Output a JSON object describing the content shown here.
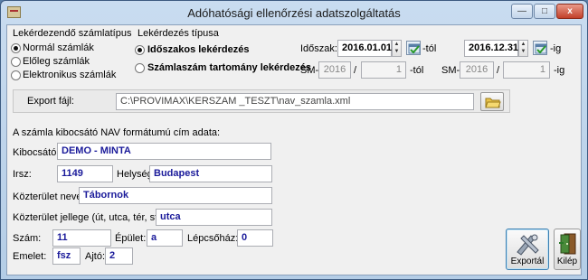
{
  "window": {
    "title": "Adóhatósági ellenőrzési adatszolgáltatás",
    "min_label": "—",
    "max_label": "□",
    "close_label": "x"
  },
  "query_type": {
    "heading": "Lekérdezendő számlatípus",
    "options": [
      "Normál számlák",
      "Előleg számlák",
      "Elektronikus számlák"
    ],
    "selected": 0
  },
  "query_mode": {
    "heading": "Lekérdezés típusa",
    "options": [
      "Időszakos lekérdezés",
      "Számlaszám tartomány lekérdezés"
    ],
    "selected": 0
  },
  "period": {
    "label": "Időszak:",
    "from": "2016.01.01.",
    "from_suffix": "-tól",
    "to": "2016.12.31.",
    "to_suffix": "-ig"
  },
  "invoice_range": {
    "prefix": "SM-",
    "from_year": "2016",
    "from_num": "1",
    "from_suffix": "-tól",
    "to_year": "2016",
    "to_num": "1",
    "to_suffix": "-ig",
    "sep": "/"
  },
  "export": {
    "label": "Export fájl:",
    "path": "C:\\PROVIMAX\\KERSZAM _TESZT\\nav_szamla.xml"
  },
  "address": {
    "heading": "A számla kibocsátó NAV formátumú cím adata:",
    "issuer_label": "Kibocsátó:",
    "issuer": "DEMO - MINTA",
    "zip_label": "Irsz:",
    "zip": "1149",
    "city_label": "Helység:",
    "city": "Budapest",
    "street_label": "Közterület neve:",
    "street": "Tábornok",
    "street_type_label": "Közterület jellege (út, utca, tér, stb.) :",
    "street_type": "utca",
    "number_label": "Szám:",
    "number": "11",
    "building_label": "Épület:",
    "building": "a",
    "stair_label": "Lépcsőház:",
    "stair": "0",
    "floor_label": "Emelet:",
    "floor": "fsz",
    "door_label": "Ajtó:",
    "door": "2"
  },
  "buttons": {
    "export": "Exportál",
    "exit": "Kilép"
  }
}
